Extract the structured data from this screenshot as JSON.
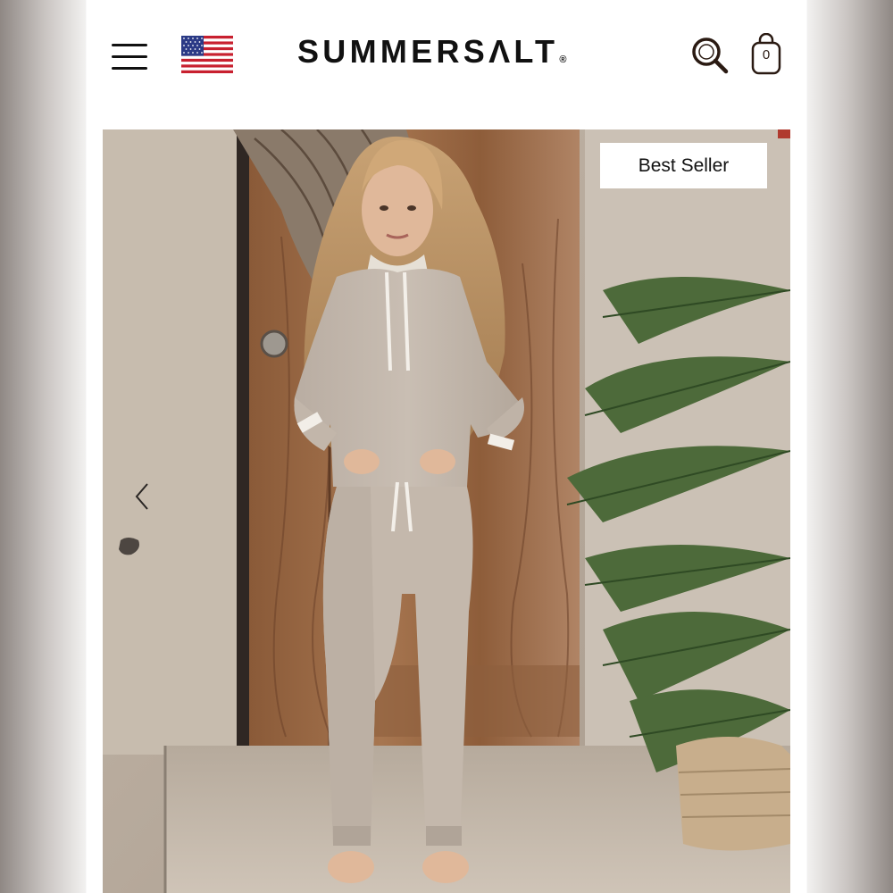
{
  "header": {
    "menu_icon": "hamburger-menu-icon",
    "country_flag": "us-flag-icon",
    "logo_text": "SUMMERSΛLT",
    "logo_mark": "®",
    "search_icon": "search-icon",
    "cart_icon": "shopping-bag-icon",
    "cart_count": "0"
  },
  "hero": {
    "badge": "Best Seller",
    "prev_icon": "chevron-left-icon",
    "image_description_icon": "product-photo"
  },
  "colors": {
    "text": "#111111",
    "badge_background": "#ffffff",
    "accent_edge": "#b03a2e"
  }
}
